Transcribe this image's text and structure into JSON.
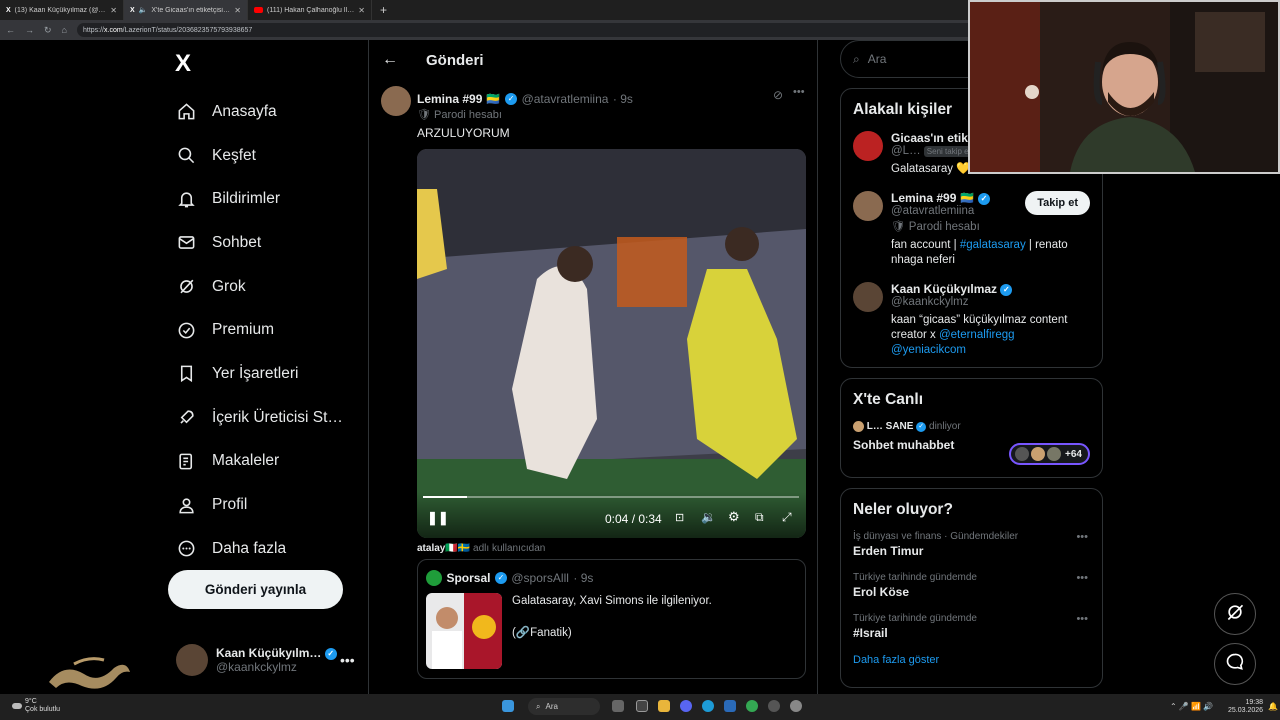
{
  "browser": {
    "tabs": [
      {
        "title": "(13) Kaan Küçükyılmaz (@kaankcy…",
        "favicon": "x-icon"
      },
      {
        "title": "X'te Gicaas'ın etiketçisi: \"@at…",
        "favicon": "x-icon"
      },
      {
        "title": "(111) Hakan Çalhanoğlu İle Milan…",
        "favicon": "youtube-icon"
      }
    ],
    "url_prefix": "https://",
    "url_domain": "x.com",
    "url_rest": "/LazerionT/status/2036823575793938657"
  },
  "sidebar": {
    "logo": "X",
    "items": [
      {
        "label": "Anasayfa",
        "icon": "home-icon"
      },
      {
        "label": "Keşfet",
        "icon": "search-icon"
      },
      {
        "label": "Bildirimler",
        "icon": "bell-icon"
      },
      {
        "label": "Sohbet",
        "icon": "mail-icon"
      },
      {
        "label": "Grok",
        "icon": "grok-icon"
      },
      {
        "label": "Premium",
        "icon": "premium-icon"
      },
      {
        "label": "Yer İşaretleri",
        "icon": "bookmark-icon"
      },
      {
        "label": "İçerik Üreticisi St…",
        "icon": "rocket-icon"
      },
      {
        "label": "Makaleler",
        "icon": "article-icon"
      },
      {
        "label": "Profil",
        "icon": "person-icon"
      },
      {
        "label": "Daha fazla",
        "icon": "more-circle-icon"
      }
    ],
    "post_button": "Gönderi yayınla",
    "account": {
      "name": "Kaan Küçükyılm…",
      "handle": "@kaankckylmz"
    }
  },
  "main": {
    "header": "Gönderi",
    "tweet": {
      "name": "Lemina #99 🇬🇦",
      "handle": "@atavratlemiina",
      "time": "· 9s",
      "parody": "🛡 Parodi hesabı",
      "text": "ARZULUYORUM",
      "video": {
        "time": "0:04 / 0:34",
        "progress": 0.118
      },
      "reply_user": "atalay🇮🇹🇸🇪",
      "reply_suffix": "adlı kullanıcıdan",
      "quote": {
        "name": "Sporsal",
        "handle": "@sporsAlll",
        "time": "· 9s",
        "line1": "Galatasaray, Xavi Simons ile ilgileniyor.",
        "line2": "(🔗Fanatik)"
      }
    }
  },
  "right": {
    "search_placeholder": "Ara",
    "relevant": {
      "title": "Alakalı kişiler",
      "people": [
        {
          "name": "Gicaas'ın etike",
          "handle": "@L…",
          "badge": "Seni takip e…",
          "bio": "Galatasaray 💛❤️"
        },
        {
          "name": "Lemina #99 🇬🇦",
          "handle": "@atavratlemiina",
          "parody": "🛡 Parodi hesabı",
          "bio_pre": "fan account | ",
          "bio_link": "#galatasaray",
          "bio_post": " | renato nhaga neferi",
          "follow": "Takip et"
        },
        {
          "name": "Kaan Küçükyılmaz",
          "handle": "@kaankckylmz",
          "bio_pre": "kaan “gicaas” küçükyılmaz content creator x ",
          "bio_link": "@eternalfiregg @yeniacikcom"
        }
      ]
    },
    "live": {
      "title": "X'te Canlı",
      "host": "L… SANE",
      "status": "dinliyor",
      "topic": "Sohbet muhabbet",
      "count": "+64"
    },
    "trends": {
      "title": "Neler oluyor?",
      "items": [
        {
          "context": "İş dünyası ve finans · Gündemdekiler",
          "topic": "Erden Timur"
        },
        {
          "context": "Türkiye tarihinde gündemde",
          "topic": "Erol Köse"
        },
        {
          "context": "Türkiye tarihinde gündemde",
          "topic": "#Israil"
        }
      ],
      "show_more": "Daha fazla göster"
    }
  },
  "taskbar": {
    "weather_temp": "9°C",
    "weather_desc": "Çok bulutlu",
    "search": "Ara",
    "time": "19:38",
    "date": "25.03.2026"
  }
}
